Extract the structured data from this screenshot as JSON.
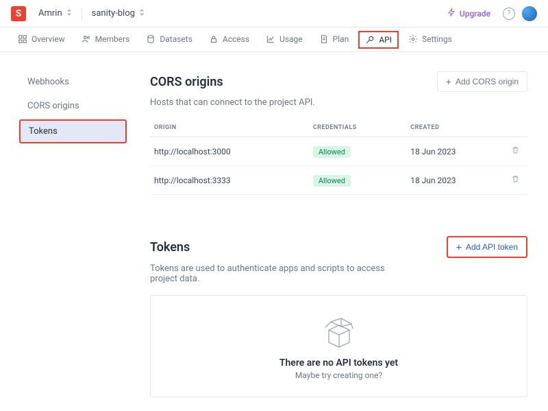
{
  "topbar": {
    "logo": "S",
    "user_crumb": "Amrin",
    "project_crumb": "sanity-blog",
    "upgrade": "Upgrade"
  },
  "tabs": [
    {
      "label": "Overview"
    },
    {
      "label": "Members"
    },
    {
      "label": "Datasets"
    },
    {
      "label": "Access"
    },
    {
      "label": "Usage"
    },
    {
      "label": "Plan"
    },
    {
      "label": "API"
    },
    {
      "label": "Settings"
    }
  ],
  "sidebar": {
    "items": [
      {
        "label": "Webhooks"
      },
      {
        "label": "CORS origins"
      },
      {
        "label": "Tokens"
      }
    ]
  },
  "cors": {
    "title": "CORS origins",
    "subtitle": "Hosts that can connect to the project API.",
    "add_label": "Add CORS origin",
    "headers": {
      "origin": "ORIGIN",
      "credentials": "CREDENTIALS",
      "created": "CREATED"
    },
    "rows": [
      {
        "origin": "http://localhost:3000",
        "credentials": "Allowed",
        "created": "18 Jun 2023"
      },
      {
        "origin": "http://localhost:3333",
        "credentials": "Allowed",
        "created": "18 Jun 2023"
      }
    ]
  },
  "tokens": {
    "title": "Tokens",
    "subtitle": "Tokens are used to authenticate apps and scripts to access project data.",
    "add_label": "Add API token",
    "empty_title": "There are no API tokens yet",
    "empty_sub": "Maybe try creating one?"
  }
}
